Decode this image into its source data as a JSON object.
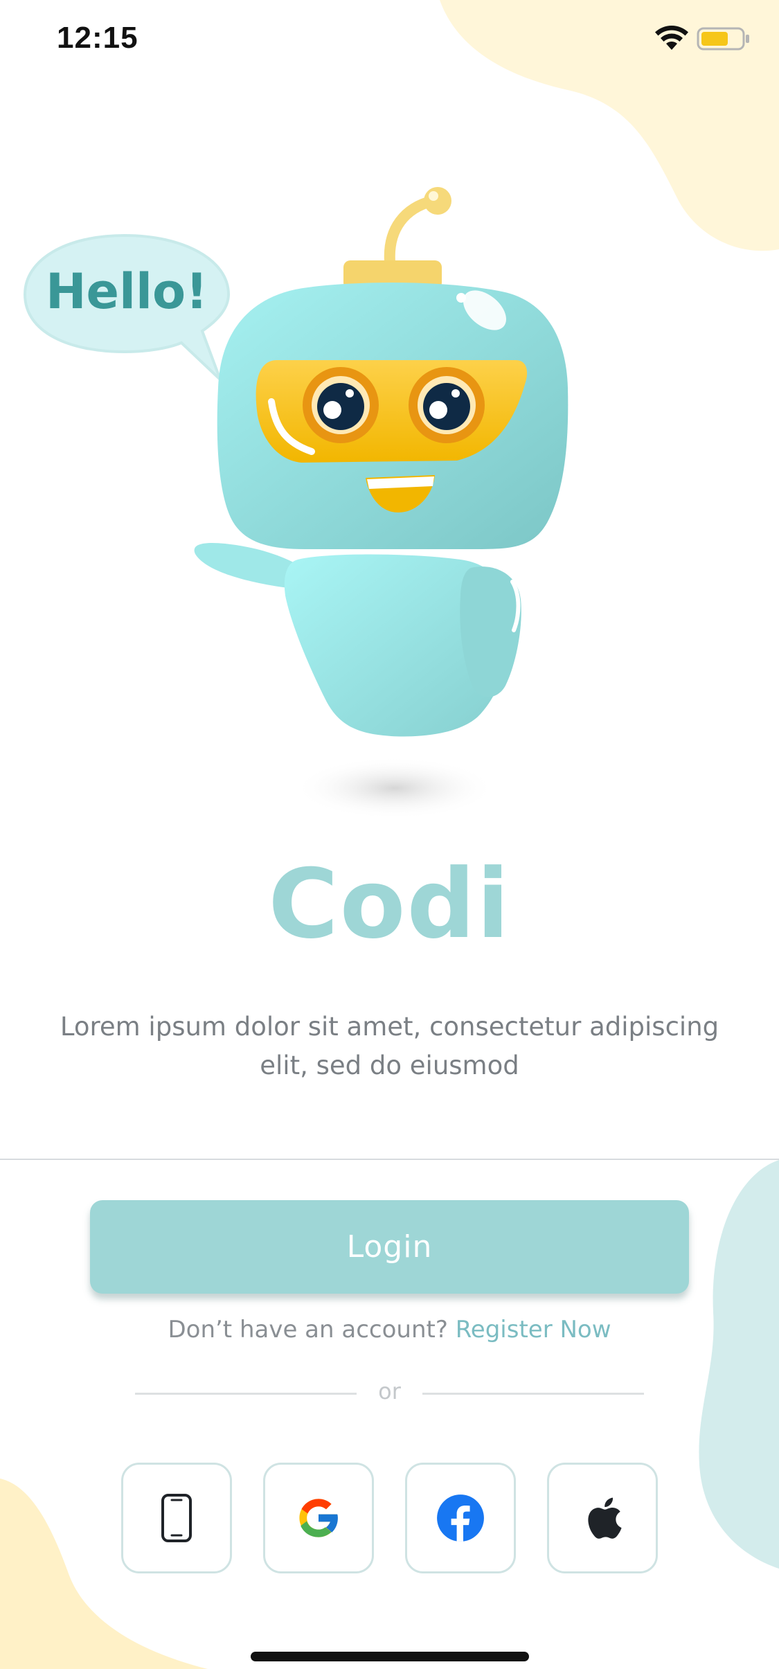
{
  "status_bar": {
    "time": "12:15"
  },
  "mascot": {
    "speech_bubble": "Hello!"
  },
  "app": {
    "title": "Codi",
    "tagline_line1": "Lorem ipsum dolor sit amet, consectetur adipiscing",
    "tagline_line2": "elit, sed do eiusmod"
  },
  "auth": {
    "login_label": "Login",
    "register_prompt": "Don’t have an account?",
    "register_link": "Register Now",
    "or_label": "or"
  },
  "social_options": [
    "phone-icon",
    "google-icon",
    "facebook-icon",
    "apple-icon"
  ],
  "colors": {
    "accent": "#9ed6d6",
    "link": "#7bbcc2",
    "blob_yellow": "#fff6d9",
    "blob_teal": "#d3ecec"
  }
}
